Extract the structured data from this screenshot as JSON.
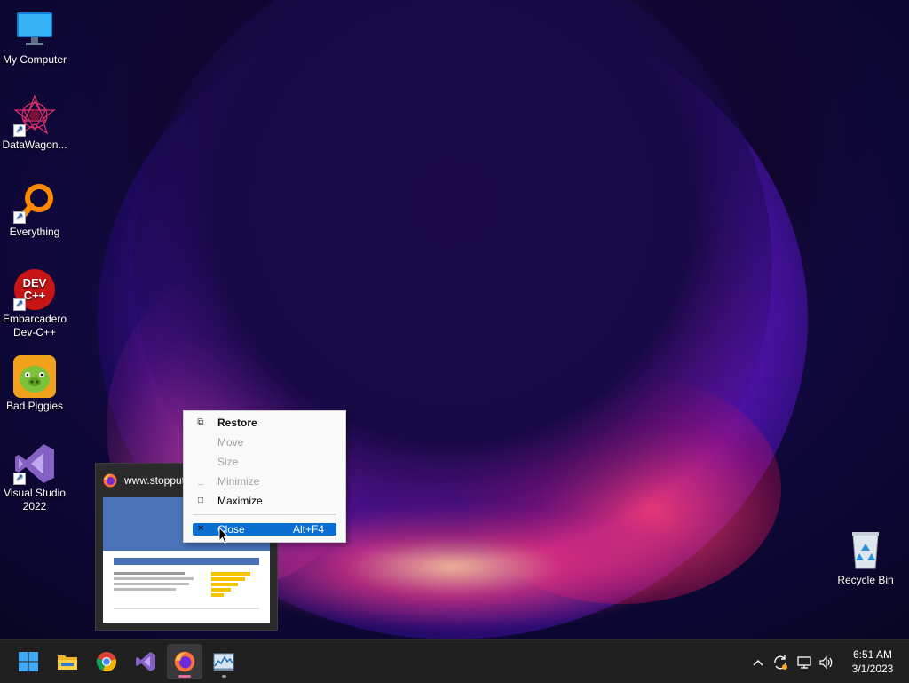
{
  "desktop": {
    "icons": [
      {
        "label": "My Computer",
        "icon": "computer-icon"
      },
      {
        "label": "DataWagon...",
        "icon": "datawagon-icon"
      },
      {
        "label": "Everything",
        "icon": "everything-search-icon"
      },
      {
        "label": "Embarcadero Dev-C++",
        "icon": "devcpp-icon",
        "badge": "DEV C++"
      },
      {
        "label": "Bad Piggies",
        "icon": "bad-piggies-icon"
      },
      {
        "label": "Visual Studio 2022",
        "icon": "visual-studio-icon"
      },
      {
        "label": "Recycle Bin",
        "icon": "recycle-bin-icon"
      }
    ]
  },
  "thumbnail": {
    "title": "www.stopput",
    "icon": "firefox-icon"
  },
  "context_menu": {
    "items": [
      {
        "label": "Restore",
        "glyph": "restore-icon",
        "enabled": true,
        "bold": true
      },
      {
        "label": "Move",
        "glyph": "",
        "enabled": false
      },
      {
        "label": "Size",
        "glyph": "",
        "enabled": false
      },
      {
        "label": "Minimize",
        "glyph": "minimize-icon",
        "enabled": false
      },
      {
        "label": "Maximize",
        "glyph": "maximize-icon",
        "enabled": true
      },
      {
        "label": "Close",
        "accelerator": "Alt+F4",
        "glyph": "close-icon",
        "enabled": true,
        "highlighted": true
      }
    ]
  },
  "taskbar": {
    "apps": [
      {
        "name": "Start",
        "icon": "windows-start-icon"
      },
      {
        "name": "File Explorer",
        "icon": "file-explorer-icon"
      },
      {
        "name": "Google Chrome",
        "icon": "chrome-icon"
      },
      {
        "name": "Visual Studio",
        "icon": "visual-studio-icon"
      },
      {
        "name": "Firefox",
        "icon": "firefox-icon",
        "active": true
      },
      {
        "name": "Resource Monitor",
        "icon": "resource-monitor-icon"
      }
    ],
    "tray": {
      "icons": [
        "chevron-up-icon",
        "update-icon",
        "network-icon",
        "volume-icon"
      ],
      "time": "6:51 AM",
      "date": "3/1/2023"
    }
  },
  "colors": {
    "menu_highlight": "#0a6fd1",
    "taskbar_bg": "#202020",
    "firefox_pill": "#e26a9f"
  }
}
